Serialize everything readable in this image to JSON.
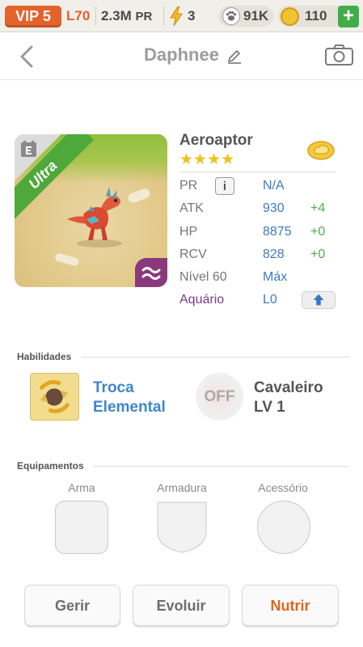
{
  "status_bar": {
    "vip": "VIP 5",
    "level": "L70",
    "pr_value": "2.3M",
    "pr_unit": "PR",
    "energy": "3",
    "paws": "91K",
    "coins": "110",
    "add": "+"
  },
  "header": {
    "title": "Daphnee"
  },
  "dino": {
    "rarity": "Ultra",
    "name": "Aeroaptor",
    "stars": "★★★★",
    "star_count": 4
  },
  "stats": {
    "pr": {
      "label": "PR",
      "info": "i",
      "value": "N/A",
      "bonus": ""
    },
    "atk": {
      "label": "ATK",
      "value": "930",
      "bonus": "+4"
    },
    "hp": {
      "label": "HP",
      "value": "8875",
      "bonus": "+0"
    },
    "rcv": {
      "label": "RCV",
      "value": "828",
      "bonus": "+0"
    },
    "level": {
      "label": "Nível 60",
      "value": "Máx"
    },
    "aquario": {
      "label": "Aquário",
      "value": "L0"
    }
  },
  "skills": {
    "heading": "Habilidades",
    "skill1": {
      "line1": "Troca",
      "line2": "Elemental"
    },
    "skill2": {
      "badge": "OFF",
      "line1": "Cavaleiro",
      "line2": "LV 1"
    }
  },
  "equipment": {
    "heading": "Equipamentos",
    "slots": [
      "Arma",
      "Armadura",
      "Acessório"
    ]
  },
  "actions": {
    "manage": "Gerir",
    "evolve": "Evoluir",
    "feed": "Nutrir"
  },
  "colors": {
    "accent_orange": "#e4622b",
    "stat_blue": "#3d7bc4",
    "bonus_green": "#4caf50",
    "rarity_green": "#4ea83a",
    "aquario_purple": "#7b3b89"
  }
}
